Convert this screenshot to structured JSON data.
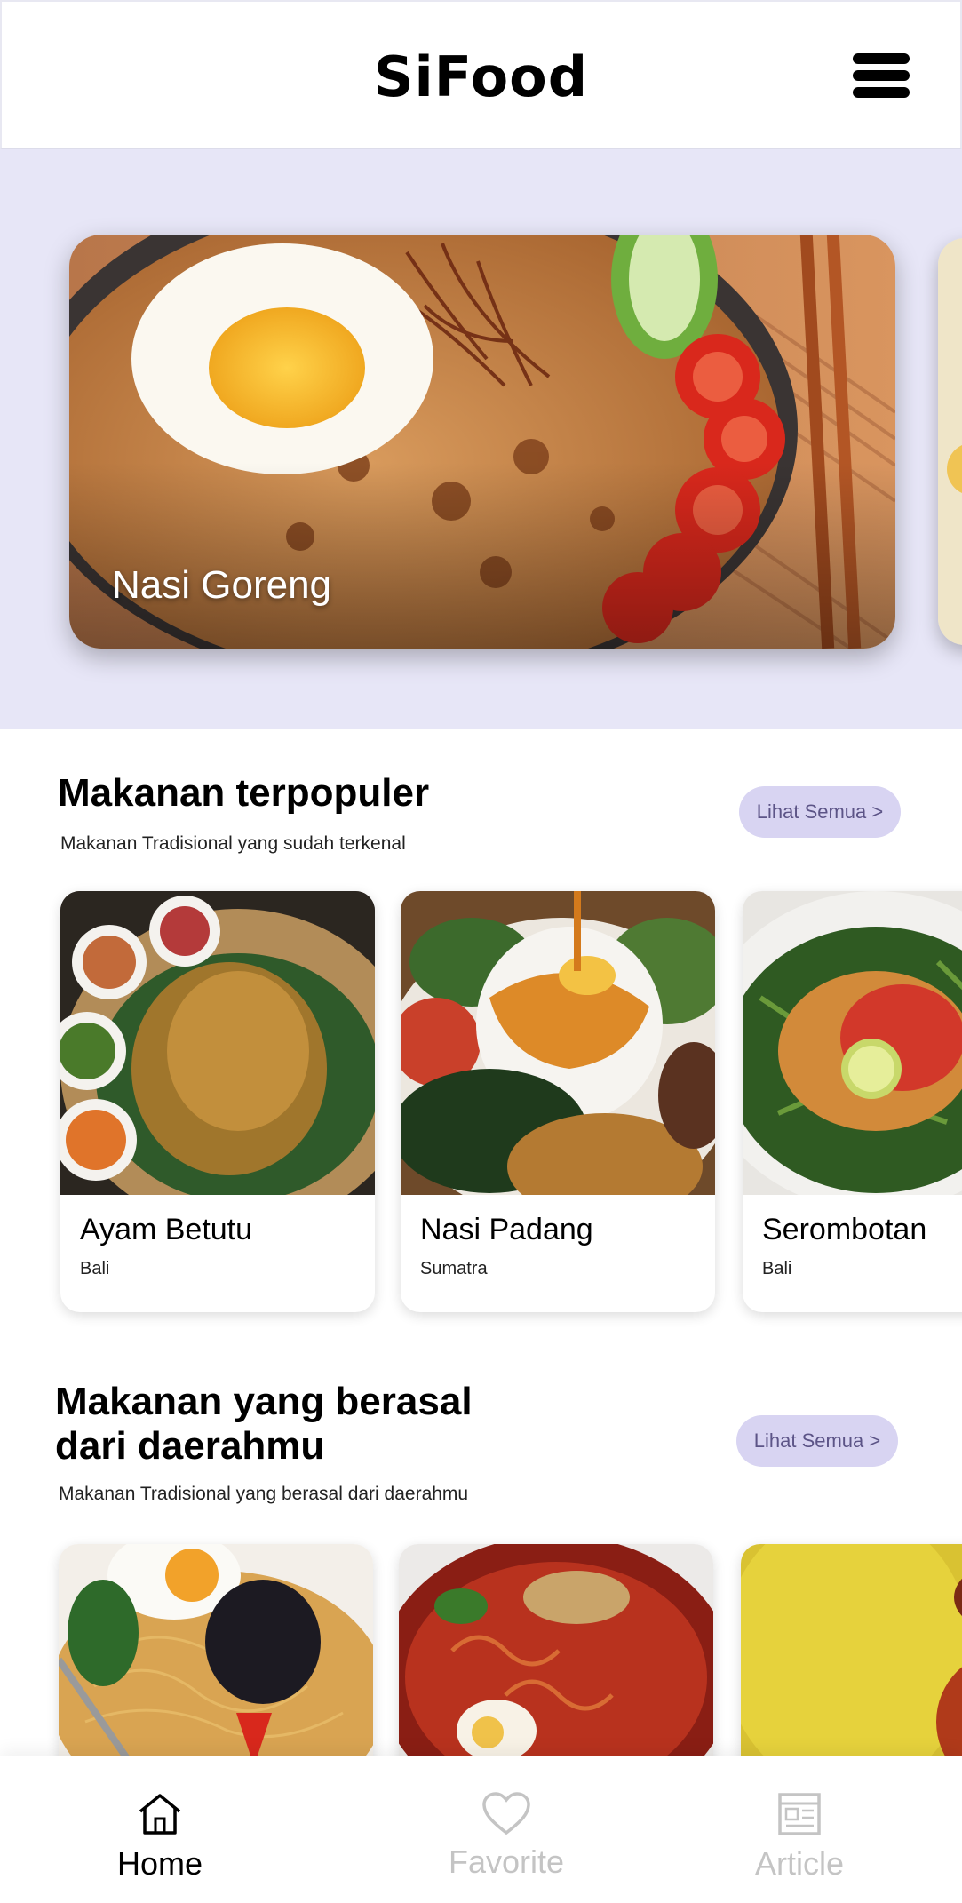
{
  "header": {
    "logo_text": "SiFood",
    "menu_icon": "hamburger-menu-icon"
  },
  "hero": {
    "title": "Nasi Goreng"
  },
  "popular": {
    "title": "Makanan terpopuler",
    "subtitle": "Makanan Tradisional yang sudah terkenal",
    "see_all": "Lihat Semua >",
    "items": [
      {
        "name": "Ayam Betutu",
        "region": "Bali"
      },
      {
        "name": "Nasi Padang",
        "region": "Sumatra"
      },
      {
        "name": "Serombotan",
        "region": "Bali"
      }
    ]
  },
  "regional": {
    "title_line1": "Makanan yang berasal",
    "title_line2": "dari daerahmu",
    "subtitle": "Makanan Tradisional yang berasal dari daerahmu",
    "see_all": "Lihat Semua >"
  },
  "nav": {
    "items": [
      {
        "label": "Home",
        "icon": "home-icon",
        "active": true
      },
      {
        "label": "Favorite",
        "icon": "heart-icon",
        "active": false
      },
      {
        "label": "Article",
        "icon": "article-icon",
        "active": false
      }
    ]
  },
  "colors": {
    "hero_bg": "#e7e6f7",
    "pill_bg": "#d8d4f2",
    "pill_text": "#5c5487",
    "active_nav": "#000000",
    "inactive_nav": "#c4c4c4",
    "logo_heart": "#e23b4a"
  }
}
